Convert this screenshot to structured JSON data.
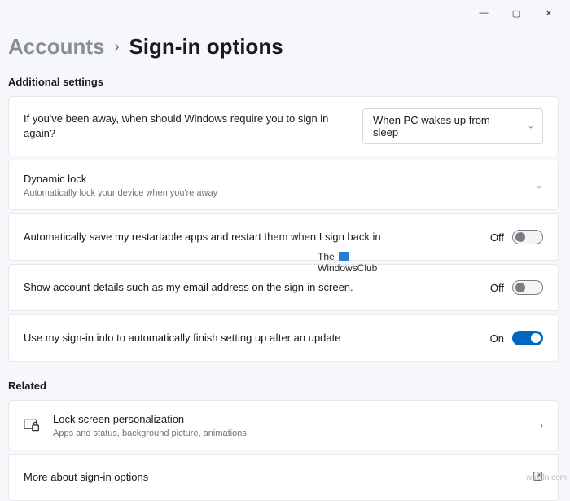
{
  "titlebar": {
    "minimize": "—",
    "maximize": "▢",
    "close": "✕"
  },
  "breadcrumb": {
    "parent": "Accounts",
    "sep": "›",
    "current": "Sign-in options"
  },
  "sections": {
    "additional": "Additional settings",
    "related": "Related"
  },
  "rows": {
    "require_signin": {
      "label": "If you've been away, when should Windows require you to sign in again?",
      "dropdown": "When PC wakes up from sleep"
    },
    "dynamic_lock": {
      "title": "Dynamic lock",
      "subtitle": "Automatically lock your device when you're away"
    },
    "restart_apps": {
      "label": "Automatically save my restartable apps and restart them when I sign back in",
      "state": "Off"
    },
    "show_account": {
      "label": "Show account details such as my email address on the sign-in screen.",
      "state": "Off"
    },
    "auto_finish": {
      "label": "Use my sign-in info to automatically finish setting up after an update",
      "state": "On"
    },
    "lock_screen": {
      "title": "Lock screen personalization",
      "subtitle": "Apps and status, background picture, animations"
    },
    "more_about": {
      "label": "More about sign-in options"
    }
  },
  "watermark": {
    "line1": "The",
    "line2": "WindowsClub"
  },
  "source": "wsxdn.com"
}
